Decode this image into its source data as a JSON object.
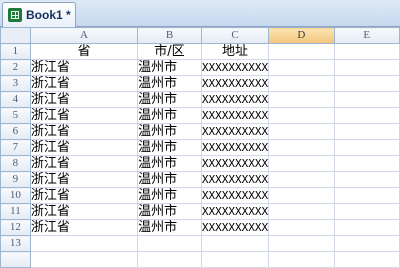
{
  "tab": {
    "label": "Book1 *"
  },
  "columns": [
    "A",
    "B",
    "C",
    "D",
    "E"
  ],
  "selected_column": "D",
  "rows": [
    {
      "num": "1",
      "a": "省",
      "b": "市/区",
      "c": "地址"
    },
    {
      "num": "2",
      "a": "浙江省",
      "b": "温州市",
      "c": "XXXXXXXXXX"
    },
    {
      "num": "3",
      "a": "浙江省",
      "b": "温州市",
      "c": "XXXXXXXXXX"
    },
    {
      "num": "4",
      "a": "浙江省",
      "b": "温州市",
      "c": "XXXXXXXXXX"
    },
    {
      "num": "5",
      "a": "浙江省",
      "b": "温州市",
      "c": "XXXXXXXXXX"
    },
    {
      "num": "6",
      "a": "浙江省",
      "b": "温州市",
      "c": "XXXXXXXXXX"
    },
    {
      "num": "7",
      "a": "浙江省",
      "b": "温州市",
      "c": "XXXXXXXXXX"
    },
    {
      "num": "8",
      "a": "浙江省",
      "b": "温州市",
      "c": "XXXXXXXXXX"
    },
    {
      "num": "9",
      "a": "浙江省",
      "b": "温州市",
      "c": "XXXXXXXXXX"
    },
    {
      "num": "10",
      "a": "浙江省",
      "b": "温州市",
      "c": "XXXXXXXXXX"
    },
    {
      "num": "11",
      "a": "浙江省",
      "b": "温州市",
      "c": "XXXXXXXXXX"
    },
    {
      "num": "12",
      "a": "浙江省",
      "b": "温州市",
      "c": "XXXXXXXXXX"
    },
    {
      "num": "13",
      "a": "",
      "b": "",
      "c": ""
    },
    {
      "num": "",
      "a": "",
      "b": "",
      "c": ""
    }
  ]
}
